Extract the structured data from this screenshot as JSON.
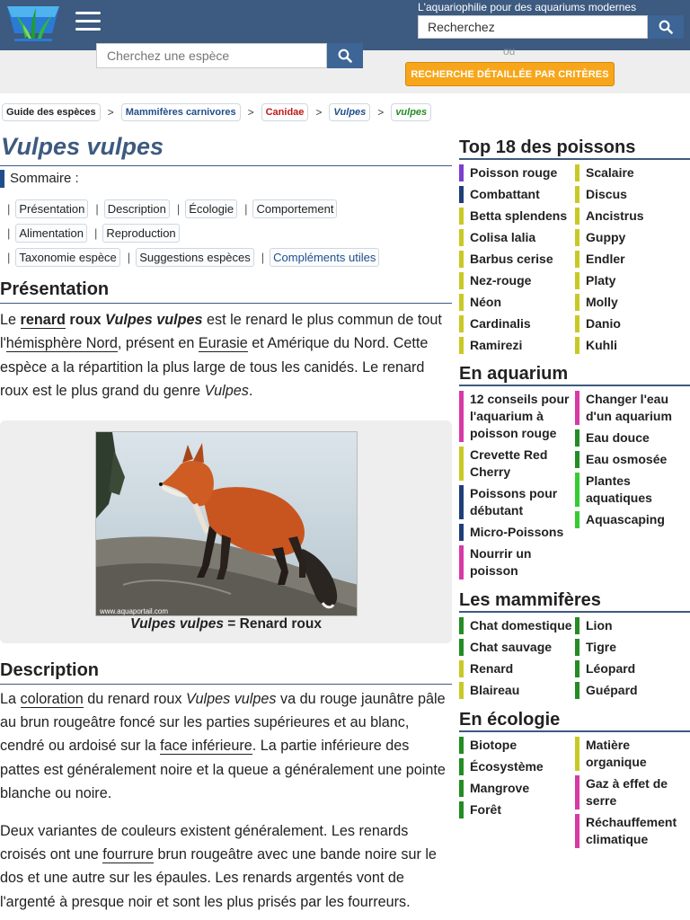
{
  "header": {
    "tagline": "L'aquariophilie pour des aquariums modernes",
    "site_search_value": "Recherchez",
    "species_search_placeholder": "Cherchez une espèce",
    "or_label": "ou",
    "advanced_search_label": "RECHERCHE DÉTAILLÉE PAR CRITÈRES"
  },
  "breadcrumb": [
    {
      "label": "Guide des espèces",
      "color": "#222222"
    },
    {
      "label": "Mammifères carnivores",
      "color": "#1f4e8c"
    },
    {
      "label": "Canidae",
      "color": "#c01818"
    },
    {
      "label": "Vulpes",
      "color": "#1f4e8c"
    },
    {
      "label": "vulpes",
      "color": "#238c23"
    }
  ],
  "breadcrumb_separator": ">",
  "main": {
    "title": "Vulpes vulpes",
    "toc_title": "Sommaire :",
    "toc": {
      "separator": "|",
      "row1": [
        "Présentation",
        "Description",
        "Écologie",
        "Comportement"
      ],
      "row2": [
        "Alimentation",
        "Reproduction"
      ],
      "row3": [
        "Taxonomie espèce",
        "Suggestions espèces",
        "Compléments utiles"
      ]
    },
    "presentation": {
      "heading": "Présentation",
      "p_le": "Le ",
      "renard": "renard",
      "roux": " roux ",
      "species": "Vulpes vulpes",
      "t1": " est le renard le plus commun de tout l'",
      "hemisphere": "hémisphère Nord",
      "t2": ", présent en ",
      "eurasie": "Eurasie",
      "t3": " et Amérique du Nord. Cette espèce a la répartition la plus large de tous les canidés. Le renard roux est le plus grand du genre ",
      "vulpes": "Vulpes",
      "t4": "."
    },
    "figure": {
      "caption_species": "Vulpes vulpes",
      "caption_rest": " = Renard roux",
      "watermark": "www.aquaportail.com"
    },
    "description": {
      "heading": "Description",
      "p1_a": "La ",
      "p1_coloration": "coloration",
      "p1_b": " du renard roux ",
      "p1_species": "Vulpes vulpes",
      "p1_c": " va du rouge jaunâtre pâle au brun rougeâtre foncé sur les parties supérieures et au blanc, cendré ou ardoisé sur la ",
      "p1_face": "face inférieure",
      "p1_d": ". La partie inférieure des pattes est généralement noire et la queue a généralement une pointe blanche ou noire.",
      "p2_a": "Deux variantes de couleurs existent généralement. Les renards croisés ont une ",
      "p2_fourrure": "fourrure",
      "p2_b": " brun rougeâtre avec une bande noire sur le dos et une autre sur les épaules. Les renards argentés vont de l'argenté à presque noir et sont les plus prisés par les fourreurs."
    }
  },
  "sidebar": {
    "top": {
      "heading": "Top 18 des poissons",
      "col1": [
        {
          "label": "Poisson rouge",
          "color": "#7b3fd1"
        },
        {
          "label": "Combattant",
          "color": "#1f3f7a"
        },
        {
          "label": "Betta splendens",
          "color": "#c9c926"
        },
        {
          "label": "Colisa lalia",
          "color": "#c9c926"
        },
        {
          "label": "Barbus cerise",
          "color": "#c9c926"
        },
        {
          "label": "Nez-rouge",
          "color": "#c9c926"
        },
        {
          "label": "Néon",
          "color": "#c9c926"
        },
        {
          "label": "Cardinalis",
          "color": "#c9c926"
        },
        {
          "label": "Ramirezi",
          "color": "#c9c926"
        }
      ],
      "col2": [
        {
          "label": "Scalaire",
          "color": "#c9c926"
        },
        {
          "label": "Discus",
          "color": "#c9c926"
        },
        {
          "label": "Ancistrus",
          "color": "#c9c926"
        },
        {
          "label": "Guppy",
          "color": "#c9c926"
        },
        {
          "label": "Endler",
          "color": "#c9c926"
        },
        {
          "label": "Platy",
          "color": "#c9c926"
        },
        {
          "label": "Molly",
          "color": "#c9c926"
        },
        {
          "label": "Danio",
          "color": "#c9c926"
        },
        {
          "label": "Kuhli",
          "color": "#c9c926"
        }
      ]
    },
    "aquarium": {
      "heading": "En aquarium",
      "col1": [
        {
          "label": "12 conseils pour l'aquarium à poisson rouge",
          "color": "#d63aa6"
        },
        {
          "label": "Crevette Red Cherry",
          "color": "#c9c926"
        },
        {
          "label": "Poissons pour débutant",
          "color": "#1f3f7a"
        },
        {
          "label": "Micro-Poissons",
          "color": "#1f3f7a"
        },
        {
          "label": "Nourrir un poisson",
          "color": "#d63aa6"
        }
      ],
      "col2": [
        {
          "label": "Changer l'eau d'un aquarium",
          "color": "#d63aa6"
        },
        {
          "label": "Eau douce",
          "color": "#238c23"
        },
        {
          "label": "Eau osmosée",
          "color": "#238c23"
        },
        {
          "label": "Plantes aquatiques",
          "color": "#33cc33"
        },
        {
          "label": "Aquascaping",
          "color": "#33cc33"
        }
      ]
    },
    "mammals": {
      "heading": "Les mammifères",
      "col1": [
        {
          "label": "Chat domestique",
          "color": "#238c23"
        },
        {
          "label": "Chat sauvage",
          "color": "#238c23"
        },
        {
          "label": "Renard",
          "color": "#c9c926"
        },
        {
          "label": "Blaireau",
          "color": "#c9c926"
        }
      ],
      "col2": [
        {
          "label": "Lion",
          "color": "#238c23"
        },
        {
          "label": "Tigre",
          "color": "#238c23"
        },
        {
          "label": "Léopard",
          "color": "#238c23"
        },
        {
          "label": "Guépard",
          "color": "#238c23"
        }
      ]
    },
    "ecology": {
      "heading": "En écologie",
      "col1": [
        {
          "label": "Biotope",
          "color": "#238c23"
        },
        {
          "label": "Écosystème",
          "color": "#238c23"
        },
        {
          "label": "Mangrove",
          "color": "#238c23"
        },
        {
          "label": "Forêt",
          "color": "#238c23"
        }
      ],
      "col2": [
        {
          "label": "Matière organique",
          "color": "#c9c926"
        },
        {
          "label": "Gaz à effet de serre",
          "color": "#d63aa6"
        },
        {
          "label": "Réchauffement climatique",
          "color": "#d63aa6"
        }
      ]
    }
  },
  "icons": {
    "logo": "aquarium-plants-logo",
    "menu": "hamburger-menu-icon",
    "search": "magnifier-icon"
  }
}
